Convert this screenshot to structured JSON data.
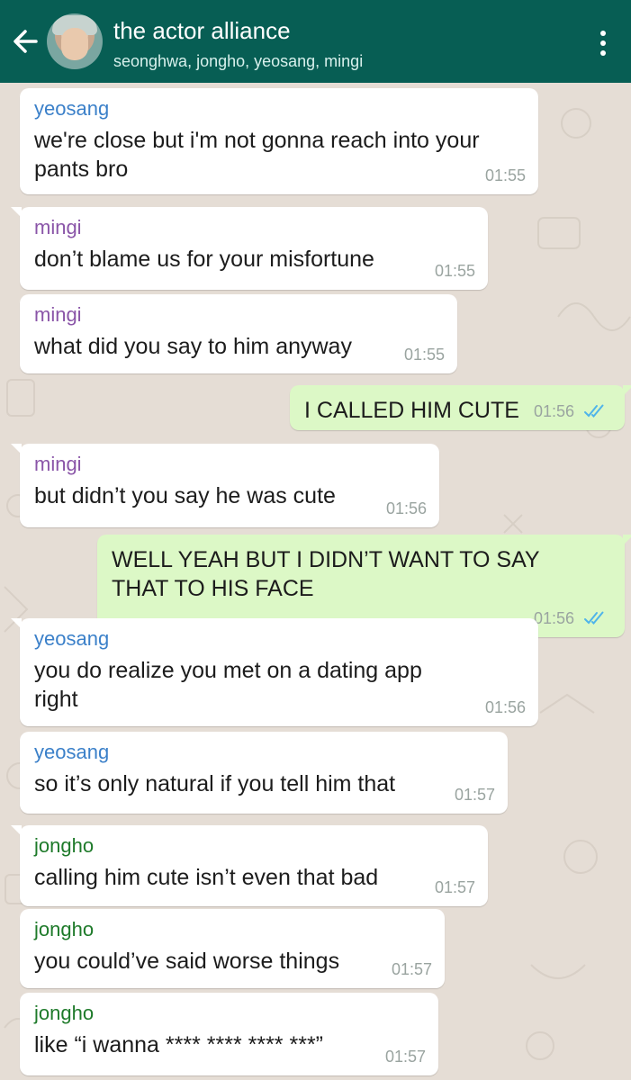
{
  "header": {
    "title": "the actor alliance",
    "members": "seonghwa, jongho, yeosang, mingi"
  },
  "colors": {
    "header": "#075e54",
    "incoming": "#ffffff",
    "outgoing": "#dcf8c6",
    "yeosang": "#3b80c9",
    "mingi": "#8a55a8",
    "jongho": "#1e7a2a"
  },
  "icons": {
    "back": "arrow-left-icon",
    "menu": "more-vert-icon",
    "read": "double-check-icon"
  },
  "messages": [
    {
      "sender": "yeosang",
      "lines": [
        "we're close but i'm not gonna reach into your",
        "pants bro"
      ],
      "time": "01:55",
      "outgoing": false
    },
    {
      "sender": "mingi",
      "lines": [
        "don’t blame us for your misfortune"
      ],
      "time": "01:55",
      "outgoing": false
    },
    {
      "sender": "mingi",
      "lines": [
        "what did you say to him anyway"
      ],
      "time": "01:55",
      "outgoing": false
    },
    {
      "sender": "",
      "lines": [
        "I CALLED HIM CUTE"
      ],
      "time": "01:56",
      "outgoing": true
    },
    {
      "sender": "mingi",
      "lines": [
        "but didn’t you say he was cute"
      ],
      "time": "01:56",
      "outgoing": false
    },
    {
      "sender": "",
      "lines": [
        "WELL YEAH BUT I DIDN’T WANT TO SAY",
        "THAT TO HIS FACE"
      ],
      "time": "01:56",
      "outgoing": true
    },
    {
      "sender": "yeosang",
      "lines": [
        "you do realize you met on a dating app",
        "right"
      ],
      "time": "01:56",
      "outgoing": false
    },
    {
      "sender": "yeosang",
      "lines": [
        "so it’s only natural if you tell him that"
      ],
      "time": "01:57",
      "outgoing": false
    },
    {
      "sender": "jongho",
      "lines": [
        "calling him cute isn’t even that bad"
      ],
      "time": "01:57",
      "outgoing": false
    },
    {
      "sender": "jongho",
      "lines": [
        "you could’ve said worse things"
      ],
      "time": "01:57",
      "outgoing": false
    },
    {
      "sender": "jongho",
      "lines": [
        "like “i wanna **** **** **** ***”"
      ],
      "time": "01:57",
      "outgoing": false
    }
  ]
}
